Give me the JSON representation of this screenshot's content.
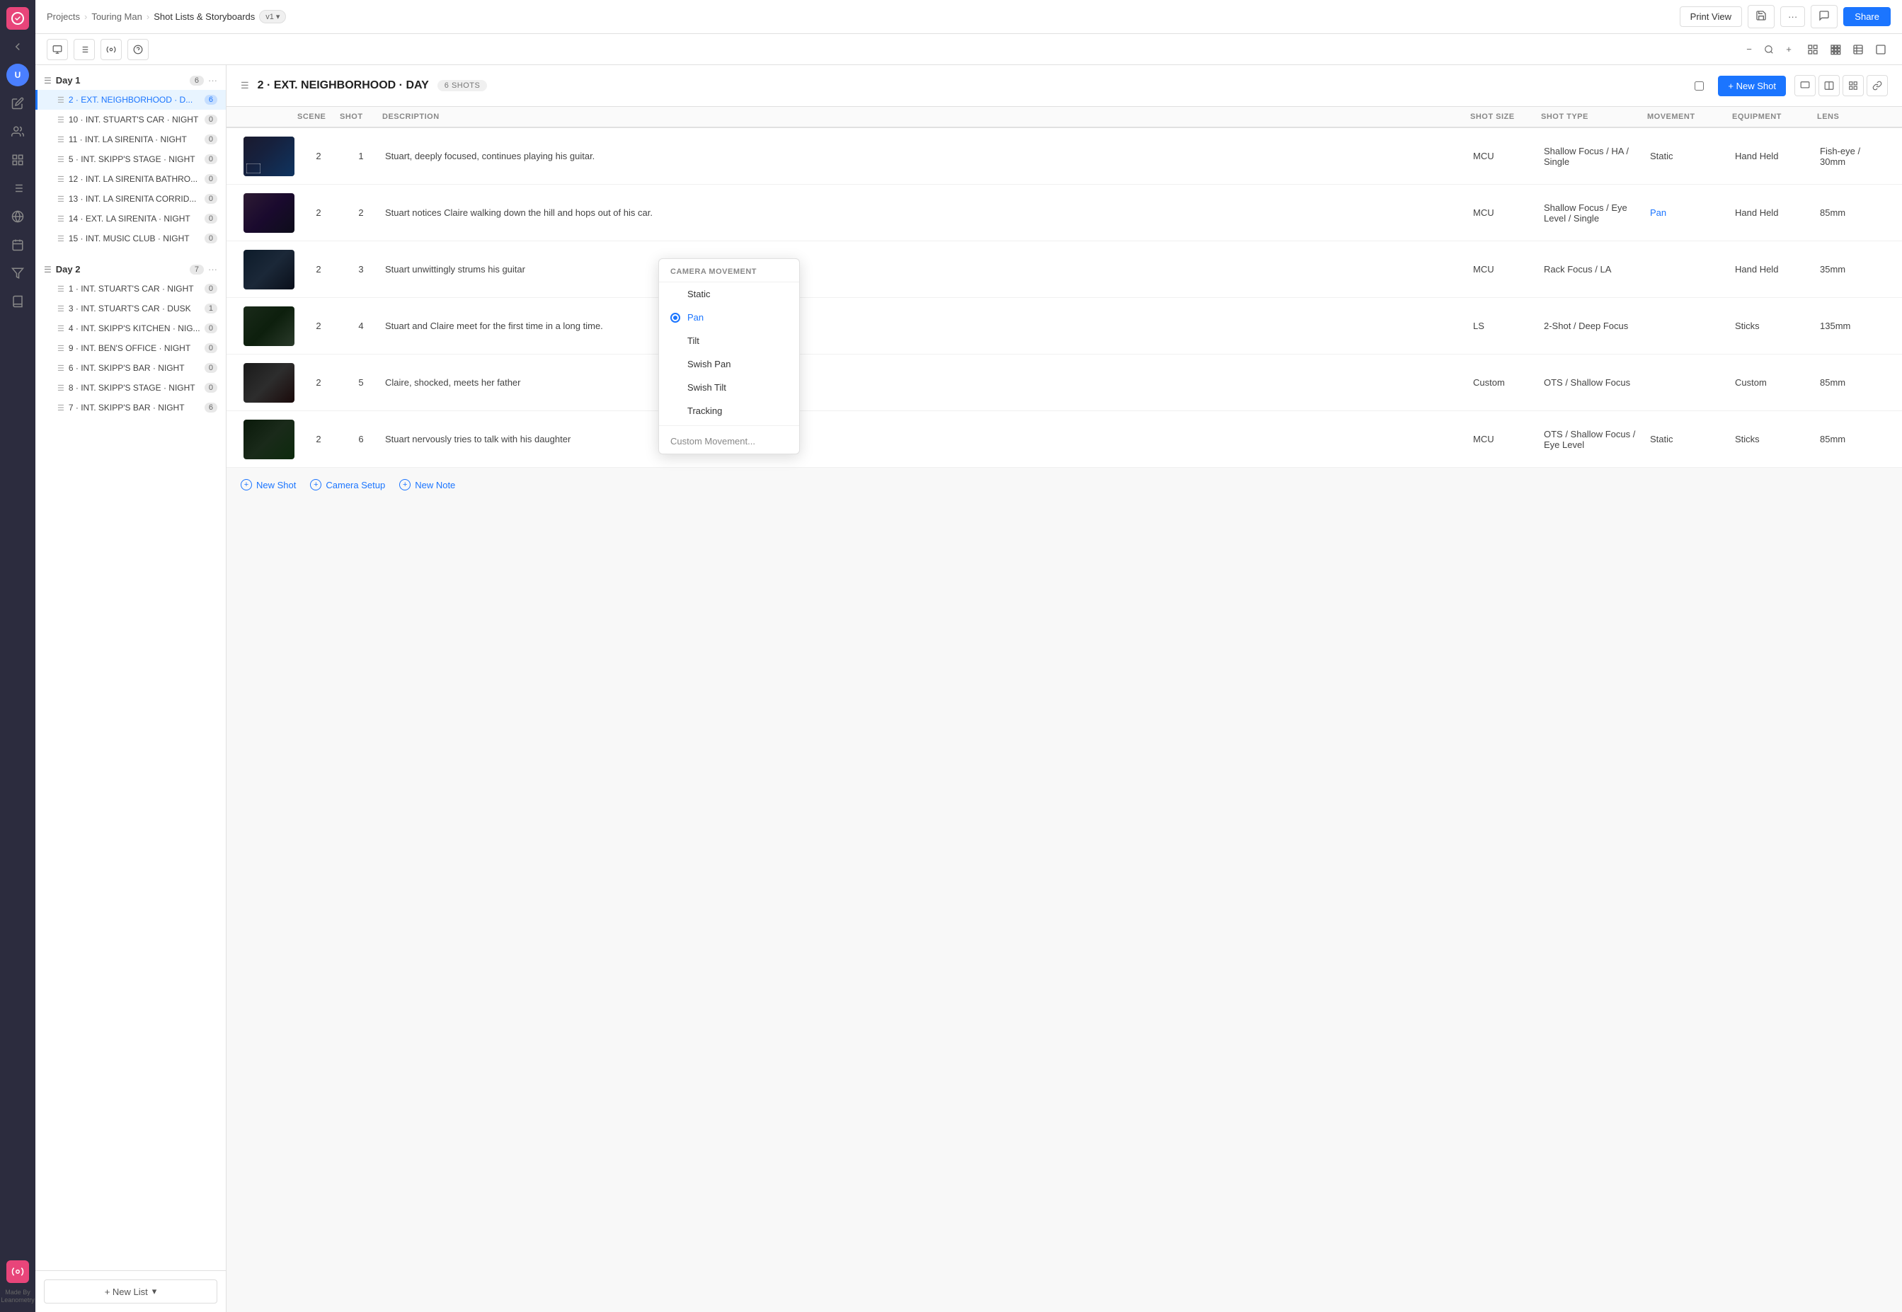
{
  "app": {
    "logo": "S",
    "breadcrumb": {
      "projects": "Projects",
      "project": "Touring Man",
      "current": "Shot Lists & Storyboards",
      "version": "v1"
    },
    "header_buttons": {
      "print": "Print View",
      "share": "Share"
    }
  },
  "sidebar": {
    "day1": {
      "label": "Day 1",
      "count": "6",
      "scenes": [
        {
          "id": "2",
          "label": "2 · EXT. NEIGHBORHOOD · D...",
          "count": "6",
          "active": true
        },
        {
          "id": "10",
          "label": "10 · INT. STUART'S CAR · NIGHT",
          "count": "0"
        },
        {
          "id": "11",
          "label": "11 · INT. LA SIRENITA · NIGHT",
          "count": "0"
        },
        {
          "id": "5",
          "label": "5 · INT. SKIPP'S STAGE · NIGHT",
          "count": "0"
        },
        {
          "id": "12",
          "label": "12 · INT. LA SIRENITA BATHRO...",
          "count": "0"
        },
        {
          "id": "13",
          "label": "13 · INT. LA SIRENITA CORRID...",
          "count": "0"
        },
        {
          "id": "14",
          "label": "14 · EXT. LA SIRENITA · NIGHT",
          "count": "0"
        },
        {
          "id": "15",
          "label": "15 · INT. MUSIC CLUB · NIGHT",
          "count": "0"
        }
      ]
    },
    "day2": {
      "label": "Day 2",
      "count": "7",
      "scenes": [
        {
          "id": "1",
          "label": "1 · INT. STUART'S CAR · NIGHT",
          "count": "0"
        },
        {
          "id": "3",
          "label": "3 · INT. STUART'S CAR · DUSK",
          "count": "1"
        },
        {
          "id": "4",
          "label": "4 · INT. SKIPP'S KITCHEN · NIG...",
          "count": "0"
        },
        {
          "id": "9",
          "label": "9 · INT. BEN'S OFFICE · NIGHT",
          "count": "0"
        },
        {
          "id": "6",
          "label": "6 · INT. SKIPP'S BAR · NIGHT",
          "count": "0"
        },
        {
          "id": "8",
          "label": "8 · INT. SKIPP'S STAGE · NIGHT",
          "count": "0"
        },
        {
          "id": "7",
          "label": "7 · INT. SKIPP'S BAR · NIGHT",
          "count": "6"
        }
      ]
    },
    "new_list_label": "+ New List"
  },
  "scene": {
    "title": "2 · EXT. NEIGHBORHOOD · DAY",
    "shots_count": "6 SHOTS",
    "new_shot_label": "+ New Shot",
    "columns": {
      "scene": "SCENE",
      "shot": "SHOT",
      "description": "DESCRIPTION",
      "shot_size": "SHOT SIZE",
      "shot_type": "SHOT TYPE",
      "movement": "MOVEMENT",
      "equipment": "EQUIPMENT",
      "lens": "LENS"
    },
    "shots": [
      {
        "scene": "2",
        "shot": "1",
        "description": "Stuart, deeply focused, continues playing his guitar.",
        "shot_size": "MCU",
        "shot_type": "Shallow Focus / HA / Single",
        "movement": "Static",
        "equipment": "Hand Held",
        "lens": "Fish-eye / 30mm",
        "thumb_class": "thumb-1"
      },
      {
        "scene": "2",
        "shot": "2",
        "description": "Stuart notices Claire walking down the hill and hops out of his car.",
        "shot_size": "MCU",
        "shot_type": "Shallow Focus / Eye Level / Single",
        "movement": "Pan",
        "equipment": "Hand Held",
        "lens": "85mm",
        "thumb_class": "thumb-2"
      },
      {
        "scene": "2",
        "shot": "3",
        "description": "Stuart unwittingly strums his guitar",
        "shot_size": "MCU",
        "shot_type": "Rack Focus / LA",
        "movement": "",
        "equipment": "Hand Held",
        "lens": "35mm",
        "thumb_class": "thumb-3"
      },
      {
        "scene": "2",
        "shot": "4",
        "description": "Stuart and Claire meet for the first time in a long time.",
        "shot_size": "LS",
        "shot_type": "2-Shot / Deep Focus",
        "movement": "",
        "equipment": "Sticks",
        "lens": "135mm",
        "thumb_class": "thumb-4"
      },
      {
        "scene": "2",
        "shot": "5",
        "description": "Claire, shocked, meets her father",
        "shot_size": "Custom",
        "shot_type": "OTS / Shallow Focus",
        "movement": "",
        "equipment": "Custom",
        "lens": "85mm",
        "thumb_class": "thumb-5"
      },
      {
        "scene": "2",
        "shot": "6",
        "description": "Stuart nervously tries to talk with his daughter",
        "shot_size": "MCU",
        "shot_type": "OTS / Shallow Focus / Eye Level",
        "movement": "Static",
        "equipment": "Sticks",
        "lens": "85mm",
        "thumb_class": "thumb-6"
      }
    ],
    "footer": {
      "new_shot": "New Shot",
      "camera_setup": "Camera Setup",
      "new_note": "New Note"
    }
  },
  "camera_movement_dropdown": {
    "title": "CAMERA MOVEMENT",
    "options": [
      {
        "label": "Static",
        "selected": false
      },
      {
        "label": "Pan",
        "selected": true
      },
      {
        "label": "Tilt",
        "selected": false
      },
      {
        "label": "Swish Pan",
        "selected": false
      },
      {
        "label": "Swish Tilt",
        "selected": false
      },
      {
        "label": "Tracking",
        "selected": false
      }
    ],
    "custom_label": "Custom Movement..."
  }
}
